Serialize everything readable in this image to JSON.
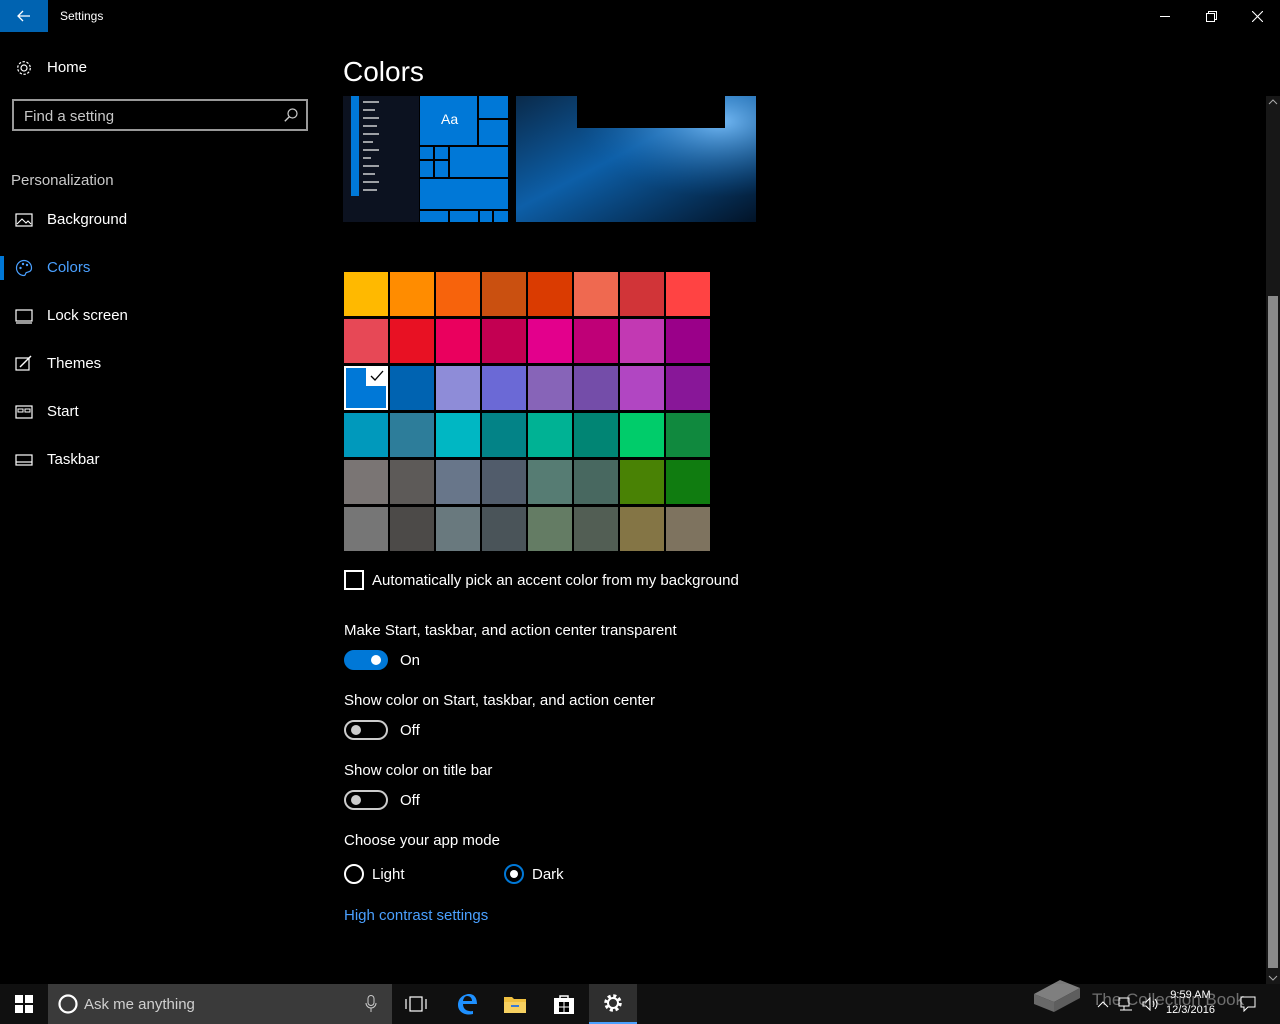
{
  "window": {
    "title": "Settings"
  },
  "sidebar": {
    "home_label": "Home",
    "search_placeholder": "Find a setting",
    "section_label": "Personalization",
    "items": [
      {
        "label": "Background",
        "icon": "image-icon"
      },
      {
        "label": "Colors",
        "icon": "palette-icon",
        "active": true
      },
      {
        "label": "Lock screen",
        "icon": "lock-screen-icon"
      },
      {
        "label": "Themes",
        "icon": "themes-icon"
      },
      {
        "label": "Start",
        "icon": "start-icon"
      },
      {
        "label": "Taskbar",
        "icon": "taskbar-icon"
      }
    ]
  },
  "main": {
    "title": "Colors",
    "preview_tile_text": "Aa",
    "swatch_colors": [
      [
        "#FFB900",
        "#FF8C00",
        "#F7630C",
        "#CA5010",
        "#DA3B01",
        "#EF6950",
        "#D13438",
        "#FF4343"
      ],
      [
        "#E74856",
        "#E81123",
        "#EA005E",
        "#C30052",
        "#E3008C",
        "#BF0077",
        "#C239B3",
        "#9A0089"
      ],
      [
        "#0078D7",
        "#0063B1",
        "#8E8CD8",
        "#6B69D6",
        "#8764B8",
        "#744DA9",
        "#B146C2",
        "#881798"
      ],
      [
        "#0099BC",
        "#2D7D9A",
        "#00B7C3",
        "#038387",
        "#00B294",
        "#018574",
        "#00CC6A",
        "#10893E"
      ],
      [
        "#7A7574",
        "#5D5A58",
        "#68768A",
        "#515C6B",
        "#567C73",
        "#486860",
        "#498205",
        "#107C10"
      ],
      [
        "#767676",
        "#4C4A48",
        "#69797E",
        "#4A5459",
        "#647C64",
        "#525E54",
        "#847545",
        "#7E735F"
      ]
    ],
    "selected_swatch": "#0078D7",
    "auto_pick_label": "Automatically pick an accent color from my background",
    "auto_pick_checked": false,
    "transparent_label": "Make Start, taskbar, and action center transparent",
    "transparent_state": "On",
    "show_color_start_label": "Show color on Start, taskbar, and action center",
    "show_color_start_state": "Off",
    "show_color_title_label": "Show color on title bar",
    "show_color_title_state": "Off",
    "app_mode_label": "Choose your app mode",
    "app_mode_options": [
      "Light",
      "Dark"
    ],
    "app_mode_selected": "Dark",
    "high_contrast_link": "High contrast settings"
  },
  "taskbar": {
    "search_placeholder": "Ask me anything",
    "time": "9:59 AM",
    "date": "12/3/2016",
    "watermark": "The Collection Book"
  },
  "colors": {
    "accent": "#0078d7",
    "link": "#4aa0ff",
    "back_button": "#0063b1"
  }
}
